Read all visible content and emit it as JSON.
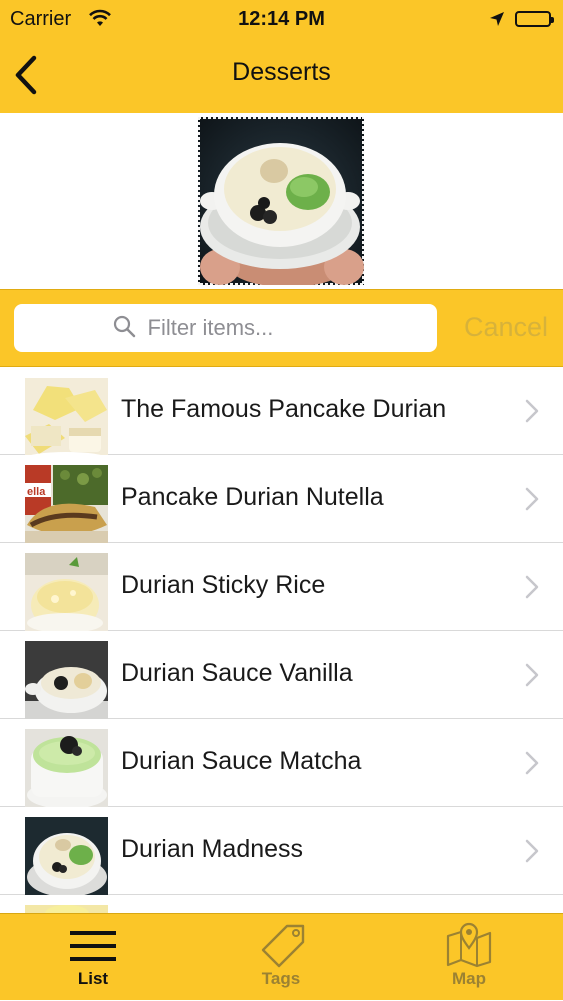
{
  "status_bar": {
    "carrier": "Carrier",
    "time": "12:14 PM"
  },
  "nav": {
    "title": "Desserts",
    "back_icon": "chevron-left-icon"
  },
  "search": {
    "placeholder": "Filter items...",
    "value": "",
    "cancel_label": "Cancel"
  },
  "items": [
    {
      "label": "The Famous Pancake Durian"
    },
    {
      "label": "Pancake Durian Nutella"
    },
    {
      "label": "Durian Sticky Rice"
    },
    {
      "label": "Durian Sauce Vanilla"
    },
    {
      "label": "Durian Sauce Matcha"
    },
    {
      "label": "Durian Madness"
    }
  ],
  "tabs": [
    {
      "label": "List",
      "icon": "hamburger-icon",
      "active": true
    },
    {
      "label": "Tags",
      "icon": "tag-icon",
      "active": false
    },
    {
      "label": "Map",
      "icon": "map-icon",
      "active": false
    }
  ],
  "colors": {
    "accent": "#fbc628",
    "cancel": "#d7b23a",
    "inactive_tab": "#9b8232"
  }
}
